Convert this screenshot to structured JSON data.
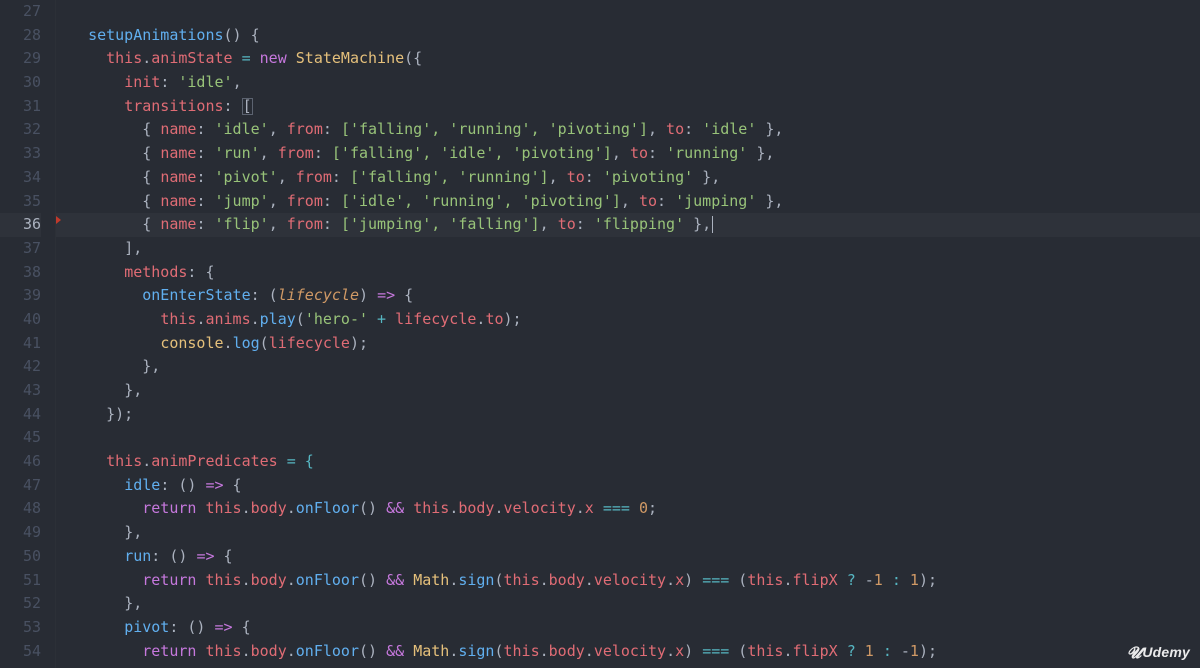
{
  "editor": {
    "first_line": 27,
    "last_line": 54,
    "highlighted_line": 36,
    "marker_line": 36,
    "cursor_line": 36
  },
  "code": {
    "line27": "",
    "line28_func": "setupAnimations",
    "line28_after": "() {",
    "line29_this": "this",
    "line29_dot": ".",
    "line29_animState": "animState",
    "line29_eq": " = ",
    "line29_new": "new",
    "line29_sp": " ",
    "line29_class": "StateMachine",
    "line29_open": "({",
    "line30_key": "init",
    "line30_colon": ": ",
    "line30_val": "'idle'",
    "line30_comma": ",",
    "line31_key": "transitions",
    "line31_colon": ": ",
    "line31_open": "[",
    "t_idle": {
      "name": "'idle'",
      "from": "['falling', 'running', 'pivoting']",
      "to": "'idle'"
    },
    "t_run": {
      "name": "'run'",
      "from": "['falling', 'idle', 'pivoting']",
      "to": "'running'"
    },
    "t_pivot": {
      "name": "'pivot'",
      "from": "['falling', 'running']",
      "to": "'pivoting'"
    },
    "t_jump": {
      "name": "'jump'",
      "from": "['idle', 'running', 'pivoting']",
      "to": "'jumping'"
    },
    "t_flip": {
      "name": "'flip'",
      "from": "['jumping', 'falling']",
      "to": "'flipping'"
    },
    "line37_close": "],",
    "line38_key": "methods",
    "line38_after": ": {",
    "line39_key": "onEnterState",
    "line39_mid": ": (",
    "line39_param": "lifecycle",
    "line39_after": ") ",
    "line39_arrow": "=>",
    "line39_brace": " {",
    "line40_a": "this",
    "line40_b": ".",
    "line40_c": "anims",
    "line40_d": ".",
    "line40_e": "play",
    "line40_f": "(",
    "line40_g": "'hero-'",
    "line40_h": " + ",
    "line40_i": "lifecycle",
    "line40_j": ".",
    "line40_k": "to",
    "line40_l": ");",
    "line41_a": "console",
    "line41_b": ".",
    "line41_c": "log",
    "line41_d": "(",
    "line41_e": "lifecycle",
    "line41_f": ");",
    "line42": "},",
    "line43": "},",
    "line44": "});",
    "line45": "",
    "line46_a": "this",
    "line46_b": ".",
    "line46_c": "animPredicates",
    "line46_d": " = {",
    "line47_key": "idle",
    "line47_after": ": () ",
    "line47_arrow": "=>",
    "line47_brace": " {",
    "line48_ret": "return",
    "line48_sp": " ",
    "line48_a": "this",
    "line48_b": ".",
    "line48_c": "body",
    "line48_d": ".",
    "line48_e": "onFloor",
    "line48_f": "() ",
    "line48_amp": "&&",
    "line48_g": " ",
    "line48_h": "this",
    "line48_i": ".",
    "line48_j": "body",
    "line48_k": ".",
    "line48_l": "velocity",
    "line48_m": ".",
    "line48_n": "x",
    "line48_o": " ",
    "line48_eq": "===",
    "line48_p": " ",
    "line48_q": "0",
    "line48_r": ";",
    "line49": "},",
    "line50_key": "run",
    "line50_after": ": () ",
    "line50_arrow": "=>",
    "line50_brace": " {",
    "line51_ret": "return",
    "line51_sp": " ",
    "line51_a": "this",
    "line51_b": ".",
    "line51_c": "body",
    "line51_d": ".",
    "line51_e": "onFloor",
    "line51_f": "() ",
    "line51_amp": "&&",
    "line51_g": " ",
    "line51_h": "Math",
    "line51_i": ".",
    "line51_j": "sign",
    "line51_k": "(",
    "line51_l": "this",
    "line51_m": ".",
    "line51_n": "body",
    "line51_o": ".",
    "line51_p": "velocity",
    "line51_q": ".",
    "line51_r": "x",
    "line51_s": ") ",
    "line51_eq": "===",
    "line51_t": " (",
    "line51_u": "this",
    "line51_v": ".",
    "line51_w": "flipX",
    "line51_x": " ",
    "line51_q1": "?",
    "line51_y": " -",
    "line51_z": "1",
    "line51_aa": " ",
    "line51_colon": ":",
    "line51_ab": " ",
    "line51_ac": "1",
    "line51_ad": ");",
    "line52": "},",
    "line53_key": "pivot",
    "line53_after": ": () ",
    "line53_arrow": "=>",
    "line53_brace": " {",
    "line54_ret": "return",
    "line54_sp": " ",
    "line54_a": "this",
    "line54_b": ".",
    "line54_c": "body",
    "line54_d": ".",
    "line54_e": "onFloor",
    "line54_f": "() ",
    "line54_amp": "&&",
    "line54_g": " ",
    "line54_h": "Math",
    "line54_i": ".",
    "line54_j": "sign",
    "line54_k": "(",
    "line54_l": "this",
    "line54_m": ".",
    "line54_n": "body",
    "line54_o": ".",
    "line54_p": "velocity",
    "line54_q": ".",
    "line54_r": "x",
    "line54_s": ") ",
    "line54_eq": "===",
    "line54_t": " (",
    "line54_u": "this",
    "line54_v": ".",
    "line54_w": "flipX",
    "line54_x": " ",
    "line54_q1": "?",
    "line54_y": " ",
    "line54_z": "1",
    "line54_aa": " ",
    "line54_colon": ":",
    "line54_ab": " -",
    "line54_ac": "1",
    "line54_ad": ");"
  },
  "labels": {
    "open_bracket_name": "name",
    "open_bracket_from": "from",
    "open_bracket_to": "to"
  },
  "watermark": "Udemy",
  "line_numbers": [
    "27",
    "28",
    "29",
    "30",
    "31",
    "32",
    "33",
    "34",
    "35",
    "36",
    "37",
    "38",
    "39",
    "40",
    "41",
    "42",
    "43",
    "44",
    "45",
    "46",
    "47",
    "48",
    "49",
    "50",
    "51",
    "52",
    "53",
    "54"
  ]
}
